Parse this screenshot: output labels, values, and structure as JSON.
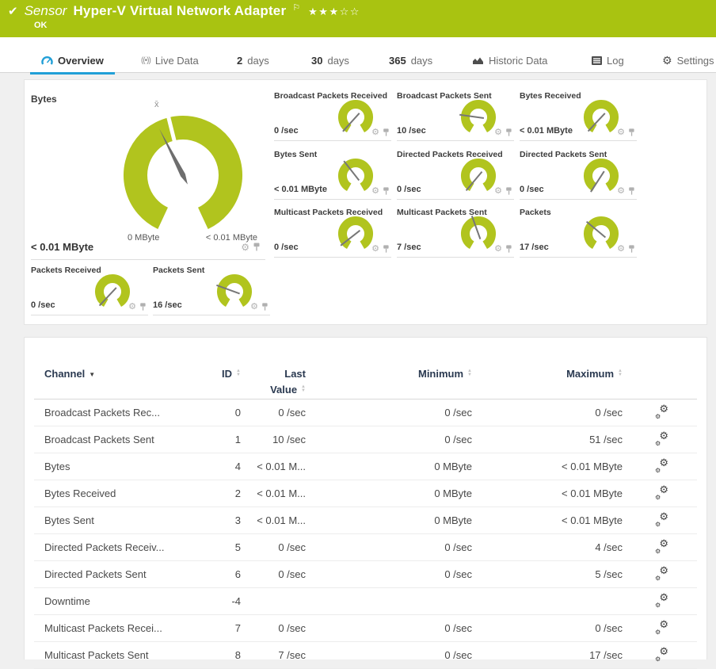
{
  "colors": {
    "brand_green": "#a9c311",
    "gauge_green": "#b1c41e",
    "accent_blue": "#219fd7",
    "panel_bg": "#ffffff",
    "page_bg": "#f0f0f0"
  },
  "header": {
    "check_icon": "✔",
    "kind": "Sensor",
    "title": "Hyper-V Virtual Network Adapter",
    "flag_icon": "⚐",
    "stars": "★★★☆☆",
    "status": "OK"
  },
  "tabs": [
    {
      "label": "Overview",
      "icon": "overview-gauge",
      "active": true
    },
    {
      "label": "Live Data",
      "icon": "live-data",
      "active": false
    },
    {
      "num": "2",
      "unit": "days",
      "active": false
    },
    {
      "num": "30",
      "unit": "days",
      "active": false
    },
    {
      "num": "365",
      "unit": "days",
      "active": false
    },
    {
      "label": "Historic Data",
      "icon": "historic-data",
      "active": false
    },
    {
      "label": "Log",
      "icon": "log",
      "active": false
    },
    {
      "label": "Settings",
      "icon": "settings-gear",
      "active": false
    }
  ],
  "gauges": {
    "main": {
      "title": "Bytes",
      "value": "< 0.01 MByte",
      "min_label": "0 MByte",
      "max_label": "< 0.01 MByte",
      "avg_marker": "x̄",
      "needle_angle": 117
    },
    "small": [
      {
        "title": "Broadcast Packets Received",
        "value": "0 /sec",
        "needle_angle": 228
      },
      {
        "title": "Broadcast Packets Sent",
        "value": "10 /sec",
        "needle_angle": 172
      },
      {
        "title": "Bytes Received",
        "value": "< 0.01 MByte",
        "needle_angle": 227
      },
      {
        "title": "Bytes Sent",
        "value": "< 0.01 MByte",
        "needle_angle": 128
      },
      {
        "title": "Directed Packets Received",
        "value": "0 /sec",
        "needle_angle": 230
      },
      {
        "title": "Directed Packets Sent",
        "value": "0 /sec",
        "needle_angle": 237
      },
      {
        "title": "Multicast Packets Received",
        "value": "0 /sec",
        "needle_angle": 218
      },
      {
        "title": "Multicast Packets Sent",
        "value": "7 /sec",
        "needle_angle": 110
      },
      {
        "title": "Packets",
        "value": "17 /sec",
        "needle_angle": 140
      },
      {
        "title": "Packets Received",
        "value": "0 /sec",
        "needle_angle": 227
      },
      {
        "title": "Packets Sent",
        "value": "16 /sec",
        "needle_angle": 160
      }
    ]
  },
  "table": {
    "headers": {
      "channel": "Channel",
      "id": "ID",
      "last_line1": "Last",
      "last_line2": "Value",
      "minimum": "Minimum",
      "maximum": "Maximum"
    },
    "rows": [
      {
        "channel": "Broadcast Packets Rec...",
        "id": "0",
        "last": "0 /sec",
        "min": "0 /sec",
        "max": "0 /sec"
      },
      {
        "channel": "Broadcast Packets Sent",
        "id": "1",
        "last": "10 /sec",
        "min": "0 /sec",
        "max": "51 /sec"
      },
      {
        "channel": "Bytes",
        "id": "4",
        "last": "< 0.01 M...",
        "min": "0 MByte",
        "max": "< 0.01 MByte"
      },
      {
        "channel": "Bytes Received",
        "id": "2",
        "last": "< 0.01 M...",
        "min": "0 MByte",
        "max": "< 0.01 MByte"
      },
      {
        "channel": "Bytes Sent",
        "id": "3",
        "last": "< 0.01 M...",
        "min": "0 MByte",
        "max": "< 0.01 MByte"
      },
      {
        "channel": "Directed Packets Receiv...",
        "id": "5",
        "last": "0 /sec",
        "min": "0 /sec",
        "max": "4 /sec"
      },
      {
        "channel": "Directed Packets Sent",
        "id": "6",
        "last": "0 /sec",
        "min": "0 /sec",
        "max": "5 /sec"
      },
      {
        "channel": "Downtime",
        "id": "-4",
        "last": "",
        "min": "",
        "max": ""
      },
      {
        "channel": "Multicast Packets Recei...",
        "id": "7",
        "last": "0 /sec",
        "min": "0 /sec",
        "max": "0 /sec"
      },
      {
        "channel": "Multicast Packets Sent",
        "id": "8",
        "last": "7 /sec",
        "min": "0 /sec",
        "max": "17 /sec"
      }
    ]
  }
}
